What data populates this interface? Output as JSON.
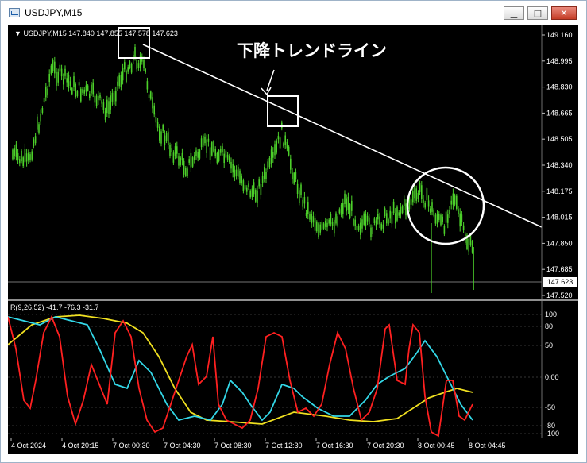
{
  "window": {
    "title": "USDJPY,M15",
    "minimize_glyph": "▁",
    "maximize_glyph": "□",
    "close_glyph": "✕"
  },
  "chart": {
    "header": "USDJPY,M15  147.840 147.855 147.578 147.623",
    "current_price": "147.623",
    "annotation": "下降トレンドライン",
    "price_labels": [
      "149.160",
      "148.995",
      "148.830",
      "148.665",
      "148.505",
      "148.340",
      "148.175",
      "148.015",
      "147.850",
      "147.685",
      "147.520"
    ],
    "time_labels": [
      "4 Oct 2024",
      "4 Oct 20:15",
      "7 Oct 00:30",
      "7 Oct 04:30",
      "7 Oct 08:30",
      "7 Oct 12:30",
      "7 Oct 16:30",
      "7 Oct 20:30",
      "8 Oct 00:45",
      "8 Oct 04:45"
    ],
    "colors": {
      "background": "#000000",
      "candles": "#4cd02a",
      "trendline": "#ffffff",
      "markers": "#ffffff"
    },
    "icons": {
      "collapse": "triangle-down-icon"
    }
  },
  "indicator": {
    "header": "R(9,26,52) -41.7 -76.3 -31.7",
    "levels": [
      "100",
      "80",
      "50",
      "0.00",
      "-50",
      "-80",
      "-100"
    ],
    "colors": {
      "red": "#ff2020",
      "cyan": "#33d8e8",
      "yellow": "#f0e020"
    }
  }
}
